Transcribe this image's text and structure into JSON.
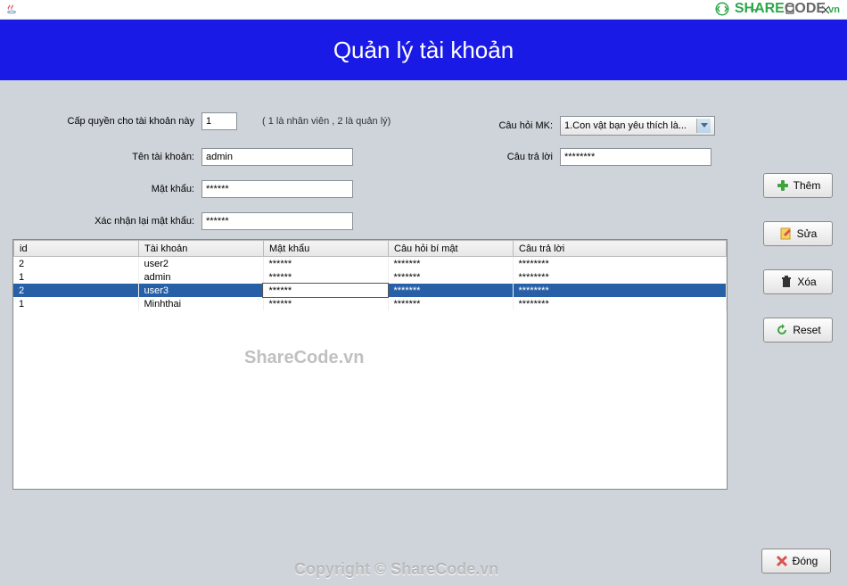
{
  "window": {
    "title": ""
  },
  "banner": {
    "title": "Quản lý tài khoản"
  },
  "form": {
    "permission_label": "Cấp quyền cho tài khoản này",
    "permission_value": "1",
    "permission_hint": "( 1 là nhân viên , 2 là quản lý)",
    "username_label": "Tên tài khoản:",
    "username_value": "admin",
    "password_label": "Mật khẩu:",
    "password_value": "******",
    "confirm_label": "Xác nhận lại mật khẩu:",
    "confirm_value": "******",
    "question_label": "Câu hỏi MK:",
    "question_value": "1.Con vật bạn yêu thích là...",
    "answer_label": "Câu trả lời",
    "answer_value": "********"
  },
  "buttons": {
    "add": "Thêm",
    "edit": "Sửa",
    "delete": "Xóa",
    "reset": "Reset",
    "close": "Đóng"
  },
  "table": {
    "headers": [
      "id",
      "Tài khoản",
      "Mật khẩu",
      "Câu hỏi bí mật",
      "Câu trả lời"
    ],
    "rows": [
      {
        "id": "2",
        "user": "user2",
        "pass": "******",
        "q": "*******",
        "a": "********",
        "selected": false
      },
      {
        "id": "1",
        "user": "admin",
        "pass": "******",
        "q": "*******",
        "a": "********",
        "selected": false
      },
      {
        "id": "2",
        "user": "user3",
        "pass": "******",
        "q": "*******",
        "a": "********",
        "selected": true,
        "editing_col": 2
      },
      {
        "id": "1",
        "user": "Minhthai",
        "pass": "******",
        "q": "*******",
        "a": "********",
        "selected": false
      }
    ]
  },
  "watermarks": {
    "wm1": "ShareCode.vn",
    "wm2": "Copyright © ShareCode.vn"
  },
  "logo": {
    "part1": "SHARE",
    "part2": "CODE",
    "part3": ".vn"
  }
}
